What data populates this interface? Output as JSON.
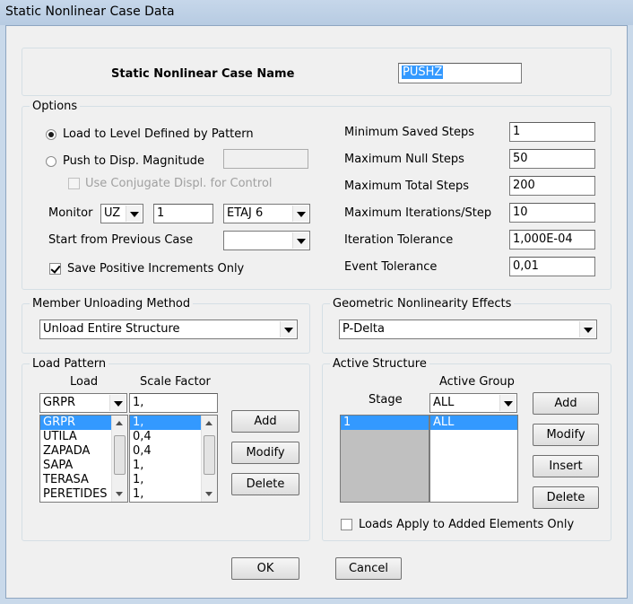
{
  "window": {
    "title": "Static Nonlinear Case  Data"
  },
  "case_name": {
    "label": "Static Nonlinear Case  Name",
    "value": "PUSHZ"
  },
  "options": {
    "title": "Options",
    "radio_load_level": "Load to Level Defined by Pattern",
    "radio_push_disp": "Push to Disp. Magnitude",
    "push_disp_value": "",
    "conjugate_label": "Use Conjugate Displ. for Control",
    "monitor_label": "Monitor",
    "monitor_dir": "UZ",
    "monitor_value": "1",
    "monitor_story": "ETAJ 6",
    "start_prev_label": "Start from Previous Case",
    "start_prev_value": "",
    "save_positive_label": "Save Positive Increments Only",
    "params": [
      {
        "label": "Minimum Saved Steps",
        "value": "1"
      },
      {
        "label": "Maximum Null Steps",
        "value": "50"
      },
      {
        "label": "Maximum Total Steps",
        "value": "200"
      },
      {
        "label": "Maximum Iterations/Step",
        "value": "10"
      },
      {
        "label": "Iteration Tolerance",
        "value": "1,000E-04"
      },
      {
        "label": "Event Tolerance",
        "value": "0,01"
      }
    ]
  },
  "unloading": {
    "title": "Member Unloading Method",
    "value": "Unload Entire Structure"
  },
  "geometric": {
    "title": "Geometric Nonlinearity Effects",
    "value": "P-Delta"
  },
  "load_pattern": {
    "title": "Load Pattern",
    "col_load": "Load",
    "col_scale": "Scale Factor",
    "load_select": "GRPR",
    "scale_input": "1,",
    "loads": [
      "GRPR",
      "UTILA",
      "ZAPADA",
      "SAPA",
      "TERASA",
      "PERETIDES"
    ],
    "scales": [
      "1,",
      "0,4",
      "0,4",
      "1,",
      "1,",
      "1,"
    ],
    "add": "Add",
    "modify": "Modify",
    "delete": "Delete"
  },
  "active_structure": {
    "title": "Active Structure",
    "col_stage": "Stage",
    "col_group": "Active Group",
    "group_select": "ALL",
    "stages": [
      "1"
    ],
    "groups": [
      "ALL"
    ],
    "add": "Add",
    "modify": "Modify",
    "insert": "Insert",
    "delete": "Delete",
    "loads_apply_label": "Loads Apply to Added Elements Only"
  },
  "footer": {
    "ok": "OK",
    "cancel": "Cancel"
  }
}
